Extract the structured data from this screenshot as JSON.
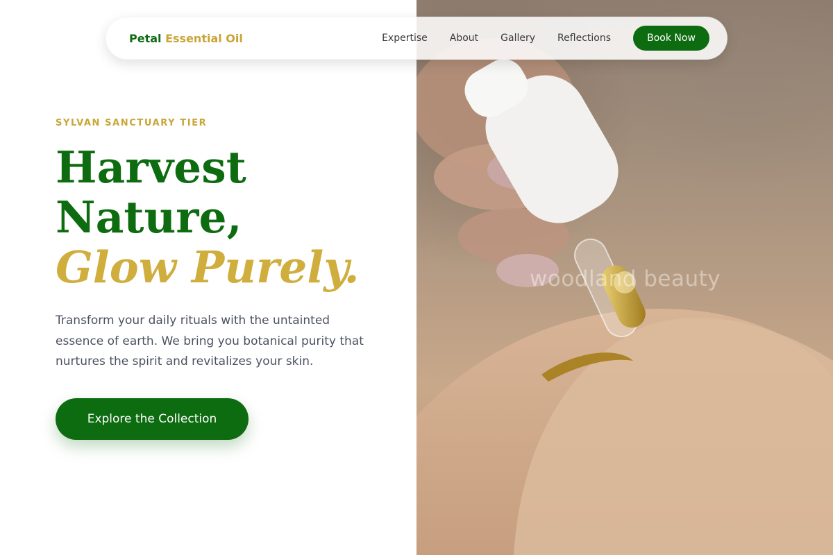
{
  "brand": {
    "name_primary": "Petal",
    "name_secondary": "Essential Oil"
  },
  "nav": {
    "links": [
      "Expertise",
      "About",
      "Gallery",
      "Reflections"
    ],
    "cta_label": "Book Now"
  },
  "hero": {
    "eyebrow": "SYLVAN SANCTUARY TIER",
    "headline_line1": "Harvest",
    "headline_line2": "Nature,",
    "headline_accent": "Glow Purely.",
    "description": "Transform your daily rituals with the untainted essence of earth. We bring you botanical purity that nurtures the spirit and revitalizes your skin.",
    "cta_label": "Explore the Collection",
    "image_watermark": "woodland beauty"
  },
  "colors": {
    "primary_green": "#0d6b10",
    "accent_gold": "#c9a536",
    "body_text": "#4b5260"
  }
}
